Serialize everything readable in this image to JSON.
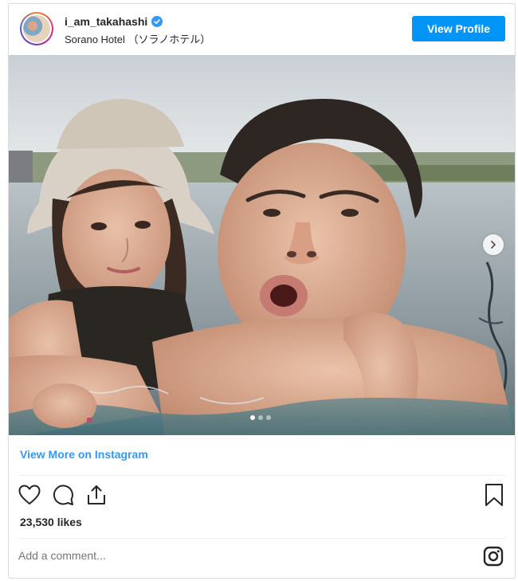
{
  "header": {
    "username": "i_am_takahashi",
    "location": "Sorano Hotel （ソラノホテル）",
    "view_profile_label": "View Profile"
  },
  "carousel": {
    "slide_count": 3,
    "active_index": 0
  },
  "view_more_label": "View More on Instagram",
  "likes_text": "23,530 likes",
  "comment": {
    "placeholder": "Add a comment..."
  },
  "colors": {
    "accent": "#0095f6",
    "link": "#3897f0"
  },
  "icons": [
    "verified-icon",
    "heart-icon",
    "comment-icon",
    "share-icon",
    "bookmark-icon",
    "chevron-right-icon",
    "instagram-icon"
  ]
}
